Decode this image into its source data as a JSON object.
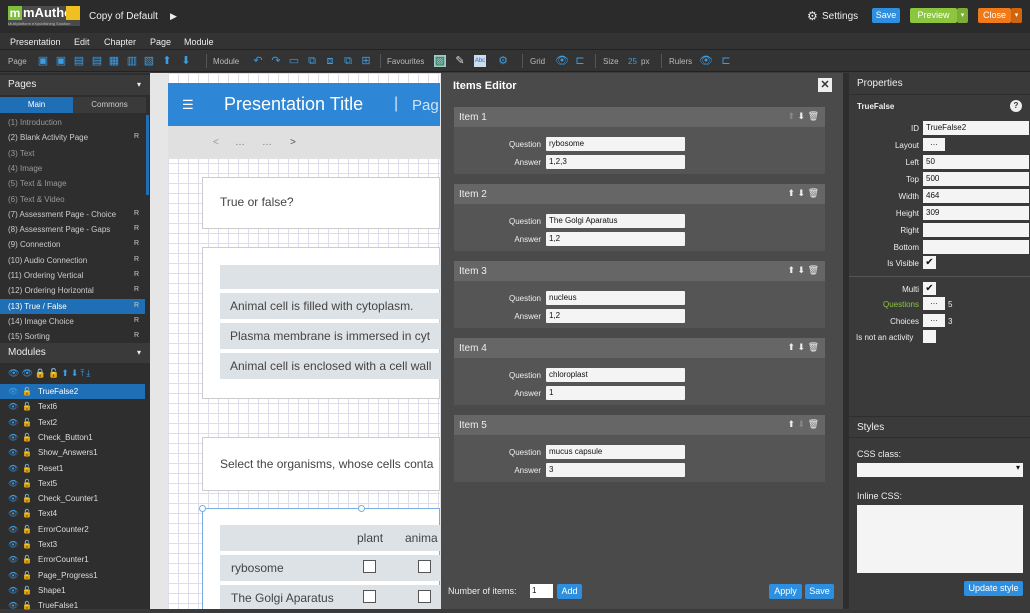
{
  "app": {
    "logo": "mAuthor",
    "logo_sub": "Multiplatform eXpublishing Solution",
    "doc_title": "Copy of Default"
  },
  "top_buttons": {
    "settings": "Settings",
    "save": "Save",
    "preview": "Preview",
    "close": "Close"
  },
  "menu": [
    "Presentation",
    "Edit",
    "Chapter",
    "Page",
    "Module"
  ],
  "toolbar": {
    "page": "Page",
    "module": "Module",
    "favourites": "Favourites",
    "grid": "Grid",
    "size": "Size",
    "size_value": "25",
    "size_unit": "px",
    "rulers": "Rulers"
  },
  "pages_panel": {
    "title": "Pages",
    "tab_main": "Main",
    "tab_commons": "Commons",
    "items": [
      {
        "label": "(1) Introduction",
        "r": ""
      },
      {
        "label": "(2) Blank Activity Page",
        "r": "R"
      },
      {
        "label": "(3) Text",
        "r": ""
      },
      {
        "label": "(4) Image",
        "r": ""
      },
      {
        "label": "(5) Text & Image",
        "r": ""
      },
      {
        "label": "(6) Text & Video",
        "r": ""
      },
      {
        "label": "(7) Assessment Page - Choice",
        "r": "R"
      },
      {
        "label": "(8) Assessment Page - Gaps",
        "r": "R"
      },
      {
        "label": "(9) Connection",
        "r": "R"
      },
      {
        "label": "(10) Audio Connection",
        "r": "R"
      },
      {
        "label": "(11) Ordering Vertical",
        "r": "R"
      },
      {
        "label": "(12) Ordering Horizontal",
        "r": "R"
      },
      {
        "label": "(13) True / False",
        "r": "R"
      },
      {
        "label": "(14) Image Choice",
        "r": "R"
      },
      {
        "label": "(15) Sorting",
        "r": "R"
      }
    ]
  },
  "modules_panel": {
    "title": "Modules",
    "items": [
      "TrueFalse2",
      "Text6",
      "Text2",
      "Check_Button1",
      "Show_Answers1",
      "Reset1",
      "Text5",
      "Check_Counter1",
      "Text4",
      "ErrorCounter2",
      "Text3",
      "ErrorCounter1",
      "Page_Progress1",
      "Shape1",
      "TrueFalse1"
    ]
  },
  "canvas": {
    "pres_title": "Presentation Title",
    "page_short": "Pag",
    "nav": [
      "<",
      "…",
      "…",
      ">"
    ],
    "q1": "True or false?",
    "statements": [
      "Animal cell is filled with cytoplasm.",
      "Plasma membrane is immersed in cyt",
      "Animal cell is enclosed with a cell wall"
    ],
    "q2": "Select the organisms, whose cells conta",
    "col_plant": "plant",
    "col_animal": "anima",
    "rows": [
      "rybosome",
      "The Golgi Aparatus"
    ]
  },
  "items_editor": {
    "title": "Items Editor",
    "question_label": "Question",
    "answer_label": "Answer",
    "items": [
      {
        "name": "Item 1",
        "question": "rybosome",
        "answer": "1,2,3"
      },
      {
        "name": "Item 2",
        "question": "The Golgi Aparatus",
        "answer": "1,2"
      },
      {
        "name": "Item 3",
        "question": "nucleus",
        "answer": "1,2"
      },
      {
        "name": "Item 4",
        "question": "chloroplast",
        "answer": "1"
      },
      {
        "name": "Item 5",
        "question": "mucus capsule",
        "answer": "3"
      }
    ],
    "number_label": "Number of items:",
    "number_value": "1",
    "add": "Add",
    "apply": "Apply",
    "save": "Save"
  },
  "properties": {
    "title": "Properties",
    "module": "TrueFalse",
    "id_label": "ID",
    "id_value": "TrueFalse2",
    "layout_label": "Layout",
    "left_label": "Left",
    "left": "50",
    "top_label": "Top",
    "top": "500",
    "width_label": "Width",
    "width": "464",
    "height_label": "Height",
    "height": "309",
    "right_label": "Right",
    "bottom_label": "Bottom",
    "visible_label": "Is Visible",
    "multi_label": "Multi",
    "questions_label": "Questions",
    "questions": "5",
    "choices_label": "Choices",
    "choices": "3",
    "not_activity_label": "Is not an activity",
    "dots": "…"
  },
  "styles": {
    "title": "Styles",
    "css_class_label": "CSS class:",
    "inline_label": "Inline CSS:",
    "update": "Update style"
  },
  "colors": {
    "accent": "#3c9ce4",
    "selected": "#1e6fb5",
    "green": "#8cc63f",
    "orange": "#f07a1a"
  }
}
